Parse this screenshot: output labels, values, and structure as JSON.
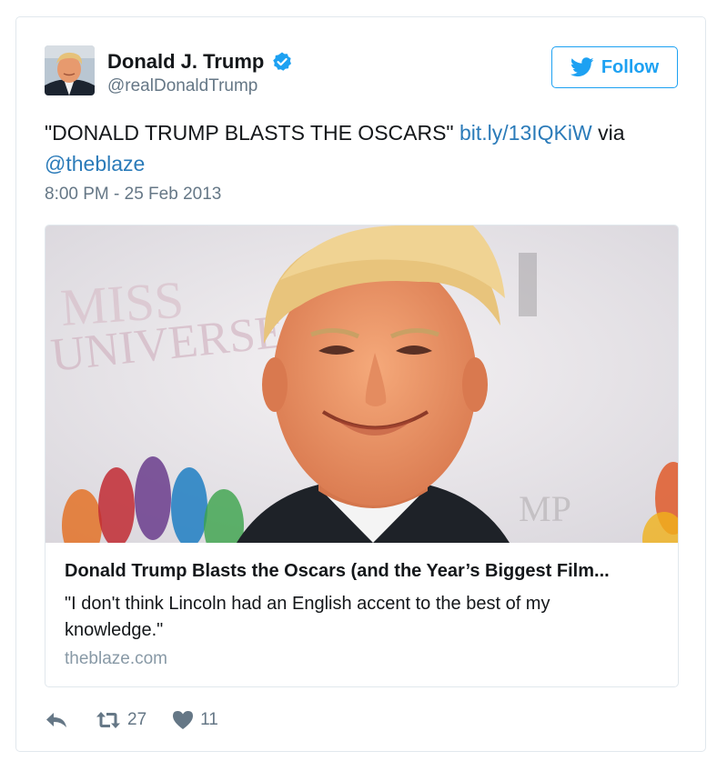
{
  "author": {
    "name": "Donald J. Trump",
    "handle": "@realDonaldTrump",
    "verified": true
  },
  "follow": {
    "label": "Follow"
  },
  "tweet": {
    "text_prefix": "\"DONALD TRUMP BLASTS THE OSCARS\" ",
    "link": "bit.ly/13IQKiW",
    "via_text": " via ",
    "mention": "@theblaze",
    "timestamp": "8:00 PM - 25 Feb 2013"
  },
  "card": {
    "title": "Donald Trump Blasts the Oscars (and the Year’s Biggest Film...",
    "description": "\"I don't think Lincoln had an English accent to the best of my knowledge.\"",
    "domain": "theblaze.com"
  },
  "actions": {
    "reply_icon": "reply-icon",
    "retweet_icon": "retweet-icon",
    "retweet_count": "27",
    "like_icon": "heart-icon",
    "like_count": "11"
  },
  "colors": {
    "accent": "#1da1f2",
    "link": "#2b7bb9",
    "muted": "#657786",
    "border": "#e1e8ed"
  }
}
